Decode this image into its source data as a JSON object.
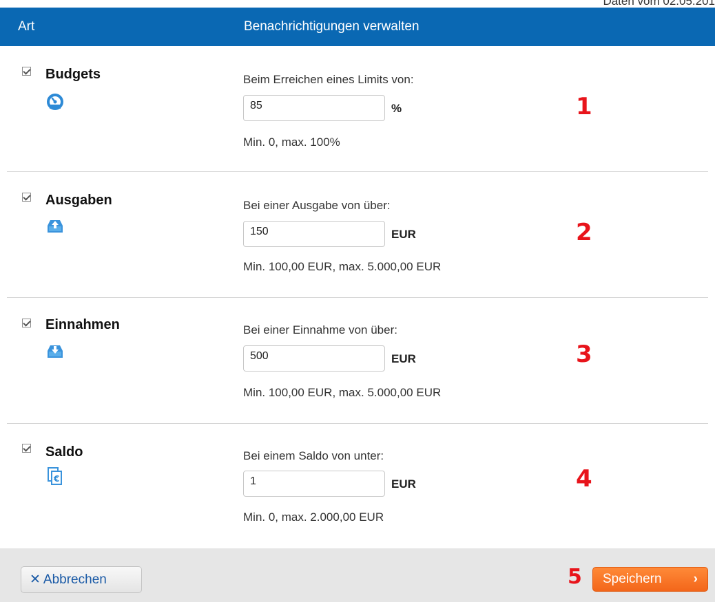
{
  "top_note": "Daten vom 02.05.201",
  "header": {
    "col_type": "Art",
    "col_manage": "Benachrichtigungen verwalten"
  },
  "rows": [
    {
      "title": "Budgets",
      "icon": "gauge-icon",
      "checked": true,
      "label": "Beim Erreichen eines Limits von:",
      "value": "85",
      "unit": "%",
      "hint": "Min. 0, max. 100%",
      "annotation": "1"
    },
    {
      "title": "Ausgaben",
      "icon": "outbox-upload-icon",
      "checked": true,
      "label": "Bei einer Ausgabe von über:",
      "value": "150",
      "unit": "EUR",
      "hint": "Min. 100,00 EUR, max. 5.000,00 EUR",
      "annotation": "2"
    },
    {
      "title": "Einnahmen",
      "icon": "inbox-download-icon",
      "checked": true,
      "label": "Bei einer Einnahme von über:",
      "value": "500",
      "unit": "EUR",
      "hint": "Min. 100,00 EUR, max. 5.000,00 EUR",
      "annotation": "3"
    },
    {
      "title": "Saldo",
      "icon": "euro-balance-icon",
      "checked": true,
      "label": "Bei einem Saldo von unter:",
      "value": "1",
      "unit": "EUR",
      "hint": "Min. 0, max. 2.000,00 EUR",
      "annotation": "4"
    }
  ],
  "footer": {
    "cancel_label": "Abbrechen",
    "save_label": "Speichern",
    "annotation": "5"
  },
  "colors": {
    "header": "#0a68b3",
    "save_button": "#f3661a",
    "annotation": "#e8141b",
    "link": "#1a5aa6"
  }
}
